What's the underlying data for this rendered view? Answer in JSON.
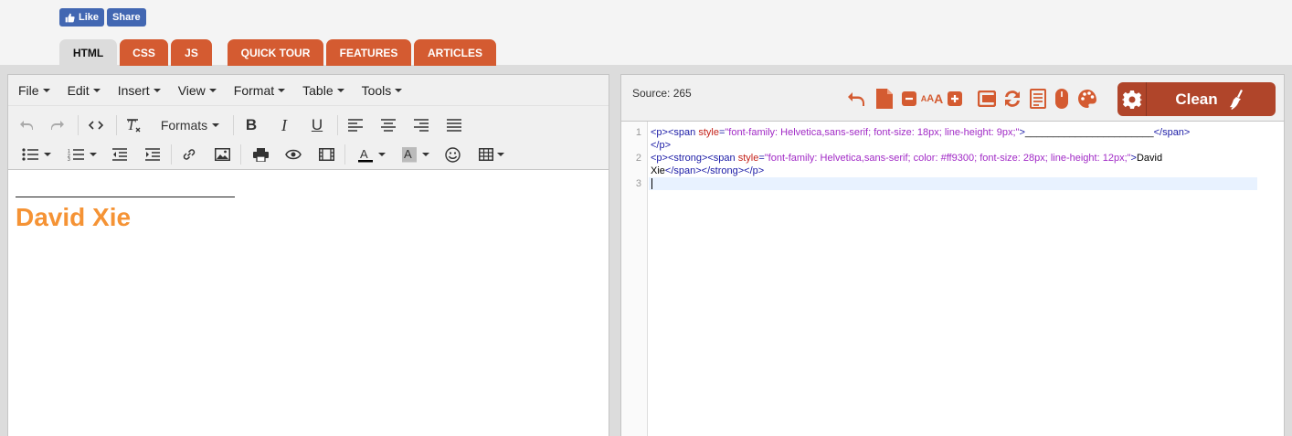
{
  "social": {
    "like_label": "Like",
    "share_label": "Share"
  },
  "tabs": [
    {
      "label": "HTML",
      "active": true
    },
    {
      "label": "CSS"
    },
    {
      "label": "JS"
    },
    {
      "label": "QUICK TOUR"
    },
    {
      "label": "FEATURES"
    },
    {
      "label": "ARTICLES"
    }
  ],
  "editor": {
    "menu": [
      "File",
      "Edit",
      "Insert",
      "View",
      "Format",
      "Table",
      "Tools"
    ],
    "formats_label": "Formats",
    "content": {
      "line": "_______________________",
      "name": "David Xie",
      "name_color": "#f59335"
    }
  },
  "source": {
    "count_label": "Source: 265",
    "clean_label": "Clean",
    "line_numbers": [
      "1",
      "2",
      "3"
    ],
    "line1a": {
      "t1": "<p><span ",
      "a1": "style",
      "t2": "=",
      "v1": "\"font-family: Helvetica,sans-serif; font-size: 18px; line-height: 9px;\"",
      "t3": ">",
      "txt": "_______________________",
      "t4": "</span>"
    },
    "line1b": "</p>",
    "line2a": {
      "t1": "<p><strong><span ",
      "a1": "style",
      "t2": "=",
      "v1": "\"font-family: Helvetica,sans-serif; color: #ff9300; font-size: 28px; line-height: 12px;\"",
      "t3": ">",
      "txt": "David"
    },
    "line2b": {
      "txt": "Xie",
      "t1": "</span></strong></p>"
    }
  },
  "colors": {
    "accent": "#d45b31",
    "clean_bg": "#b0452a",
    "tab_active": "#dcdcdc",
    "facebook": "#4267b2"
  }
}
